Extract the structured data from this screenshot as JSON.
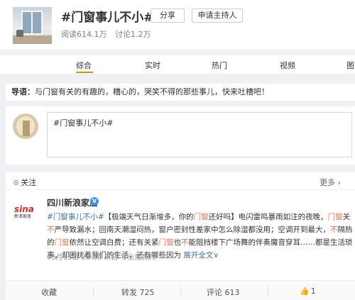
{
  "topic": {
    "title": "#门窗事儿不小#",
    "share_label": "分享",
    "host_label": "申请主持人",
    "reads": "阅读614.1万",
    "comments": "讨论1.2万"
  },
  "tabs": [
    {
      "label": "综合",
      "active": true
    },
    {
      "label": "实时"
    },
    {
      "label": "热门"
    },
    {
      "label": "视频"
    },
    {
      "label": "图"
    }
  ],
  "guide": {
    "prefix": "导语：",
    "text": "与门窗有关的有趣的，糟心的，哭笑不得的那些事儿，快来吐槽吧！"
  },
  "composer": {
    "text": "#门窗事儿不小#"
  },
  "post": {
    "follow_label": "关注",
    "more_label": "更多",
    "author": "四川新浪家居",
    "logo_main": "sina",
    "logo_sub": "新浪家居",
    "text_parts": {
      "tag_a": "#",
      "tag_b": "门窗事儿不小",
      "tag_c": "#",
      "p1": "【极端天气日渐增多，你的",
      "door1": "门窗",
      "p2": "还好吗】电闪雷鸣暴雨如注的夜晚，",
      "door2": "门窗",
      "p3": "关",
      "not1": "不",
      "p4": "严导致漏水；回南天潮湿闷热，窗户密封性差家中怎么除湿都没用；空调开到最大，",
      "not2": "不",
      "p5": "隔热的",
      "door3": "门窗",
      "p6": "依然让空调白费；还有关紧",
      "door4": "门窗",
      "p7": "也",
      "not3": "不",
      "p8": "能阻挡楼下广场舞的伴奏魔音穿耳……都是生活琐事，却困扰着我们的生活，还有哪些因为",
      "expand": "展开全文",
      "expand_arrow": "∨"
    },
    "meta": "05月15日 20:55  来自 专业版微博",
    "actions": {
      "collect": "收藏",
      "repost": "转发 725",
      "comment": "评论 613",
      "like": "1"
    }
  },
  "colors": {
    "accent": "#ff8200",
    "highlight": "#eb7350",
    "link": "#3b6fa6",
    "verified": "#3b8ff0"
  },
  "icons": {
    "expand": "chevron-down-icon",
    "like": "thumb-up-icon",
    "verified": "verified-badge-icon"
  }
}
